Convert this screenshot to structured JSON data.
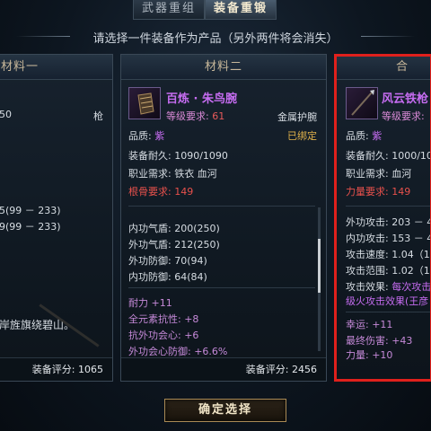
{
  "tabs": [
    {
      "label": "武器重组",
      "active": false
    },
    {
      "label": "装备重锻",
      "active": true
    }
  ],
  "instruction": "请选择一件装备作为产品（另外两件将会消失）",
  "cards": {
    "left": {
      "header": "材料一",
      "rows": {
        "lv_partial": "50",
        "weapon_type": "枪",
        "atk1": "5(99 － 233)",
        "atk2": "9(99 － 233)",
        "flavor": "岸旌旗绕碧山。"
      },
      "score_label": "装备评分:",
      "score": "1065"
    },
    "middle": {
      "header": "材料二",
      "item_name": "百炼 · 朱鸟腕",
      "level_req_label": "等级要求:",
      "level_req": "61",
      "slot": "金属护腕",
      "quality_label": "品质:",
      "quality": "紫",
      "bound": "已绑定",
      "durability_label": "装备耐久:",
      "durability": "1090/1090",
      "class_label": "职业需求:",
      "classes": "铁衣  血河",
      "root_req_label": "根骨要求:",
      "root_req": "149",
      "stats": [
        {
          "label": "内功气盾:",
          "value": "200(250)"
        },
        {
          "label": "外功气盾:",
          "value": "212(250)"
        },
        {
          "label": "外功防御:",
          "value": "70(94)"
        },
        {
          "label": "内功防御:",
          "value": "64(84)"
        }
      ],
      "bonus": [
        {
          "label": "耐力",
          "value": "+11"
        },
        {
          "label": "全元素抗性:",
          "value": "+8"
        },
        {
          "label": "抗外功会心:",
          "value": "+6"
        },
        {
          "label": "外功会心防御:",
          "value": "+6.6%"
        }
      ],
      "score_label": "装备评分:",
      "score": "2456",
      "scroll_fraction": 0.35
    },
    "right": {
      "header": "合",
      "item_name": "风云铁枪",
      "level_req_label": "等级要求:",
      "quality_label": "品质:",
      "quality": "紫",
      "durability_label": "装备耐久:",
      "durability": "1000/10",
      "class_label": "职业需求:",
      "classes": "血河",
      "str_req_label": "力量要求:",
      "str_req": "149",
      "stats": [
        {
          "label": "外功攻击:",
          "value": "203 － 43"
        },
        {
          "label": "内功攻击:",
          "value": "153 － 4"
        },
        {
          "label": "攻击速度:",
          "value": "1.04（1.0"
        },
        {
          "label": "攻击范围:",
          "value": "1.02（1.0"
        }
      ],
      "effect_label": "攻击效果:",
      "effect": "每次攻击",
      "effect_line2": "级火攻击效果(王彦",
      "bonus": [
        {
          "label": "幸运:",
          "value": "+11"
        },
        {
          "label": "最终伤害:",
          "value": "+43"
        },
        {
          "label": "力量:",
          "value": "+10"
        }
      ]
    }
  },
  "confirm_label": "确定选择",
  "colors": {
    "selected_frame": "#e0201c",
    "item_name": "#c56cf0",
    "requirement": "#e8514c",
    "bound": "#e0b14a"
  },
  "icons": {
    "middle_item": "bracer-icon",
    "right_item": "spear-icon"
  }
}
